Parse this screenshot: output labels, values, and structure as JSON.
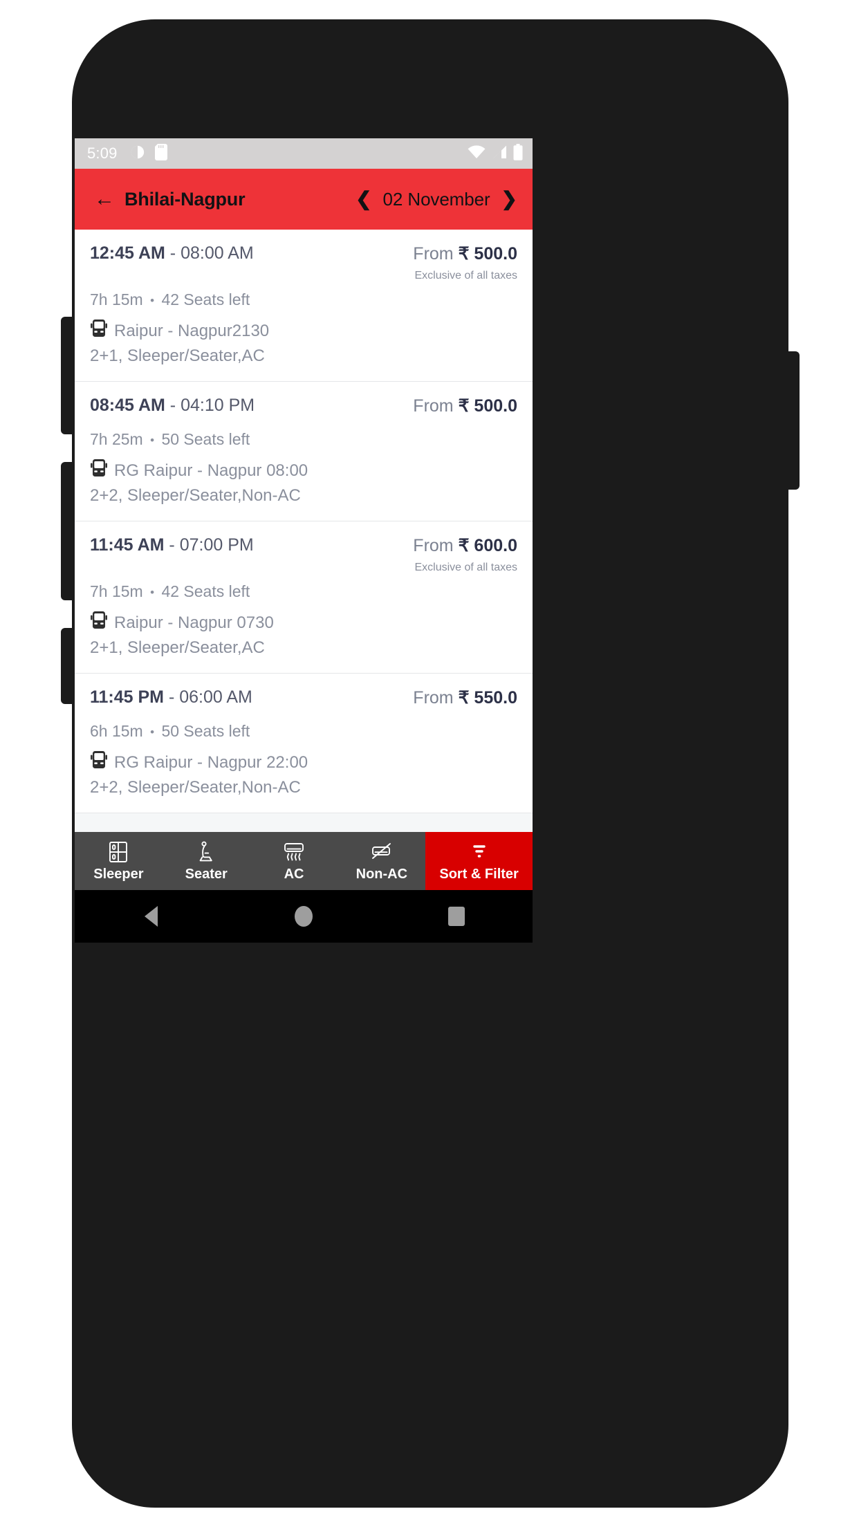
{
  "status_bar": {
    "time": "5:09",
    "left_icons": [
      "alarm-icon",
      "sd-card-icon"
    ],
    "right_icons": [
      "wifi-icon",
      "cellular-signal-icon",
      "battery-icon"
    ]
  },
  "app_bar": {
    "back_icon": "back-arrow-icon",
    "title": "Bhilai-Nagpur",
    "prev_icon": "chevron-left-icon",
    "date": "02 November",
    "next_icon": "chevron-right-icon",
    "background": "#EE3338"
  },
  "buses": [
    {
      "departure": "12:45 AM",
      "separator": "-",
      "arrival": "08:00 AM",
      "duration": "7h 15m",
      "bullet": "•",
      "seats": "42 Seats left",
      "operator": "Raipur - Nagpur2130",
      "seating": "2+1, Sleeper/Seater,AC",
      "price_from": "From",
      "price": "₹ 500.0",
      "tax_note": "Exclusive of all taxes"
    },
    {
      "departure": "08:45 AM",
      "separator": "-",
      "arrival": "04:10 PM",
      "duration": "7h 25m",
      "bullet": "•",
      "seats": "50 Seats left",
      "operator": "RG Raipur - Nagpur 08:00",
      "seating": "2+2, Sleeper/Seater,Non-AC",
      "price_from": "From",
      "price": "₹ 500.0",
      "tax_note": ""
    },
    {
      "departure": "11:45 AM",
      "separator": "-",
      "arrival": "07:00 PM",
      "duration": "7h 15m",
      "bullet": "•",
      "seats": "42 Seats left",
      "operator": "Raipur - Nagpur 0730",
      "seating": "2+1, Sleeper/Seater,AC",
      "price_from": "From",
      "price": "₹ 600.0",
      "tax_note": "Exclusive of all taxes"
    },
    {
      "departure": "11:45 PM",
      "separator": "-",
      "arrival": "06:00 AM",
      "duration": "6h 15m",
      "bullet": "•",
      "seats": "50 Seats left",
      "operator": "RG Raipur - Nagpur 22:00",
      "seating": "2+2, Sleeper/Seater,Non-AC",
      "price_from": "From",
      "price": "₹ 550.0",
      "tax_note": ""
    }
  ],
  "filter_bar": {
    "background": "#4A4A4A",
    "accent": "#D80000",
    "items": [
      {
        "label": "Sleeper",
        "icon": "sleeper-berth-icon"
      },
      {
        "label": "Seater",
        "icon": "seat-icon"
      },
      {
        "label": "AC",
        "icon": "air-conditioner-icon"
      },
      {
        "label": "Non-AC",
        "icon": "air-conditioner-crossed-icon"
      },
      {
        "label": "Sort & Filter",
        "icon": "filter-lines-icon"
      }
    ]
  },
  "nav_bar": {
    "back": "back-triangle-icon",
    "home": "home-circle-icon",
    "recents": "recents-square-icon"
  }
}
